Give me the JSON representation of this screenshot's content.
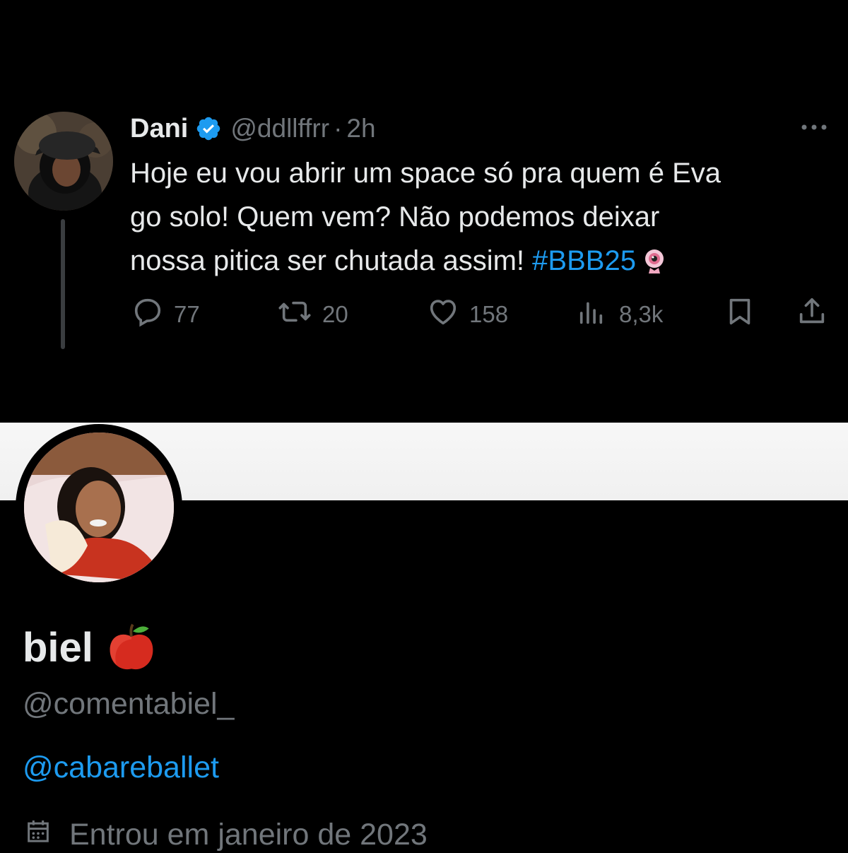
{
  "tweet": {
    "author_name": "Dani",
    "author_handle": "@ddllffrr",
    "separator": "·",
    "time": "2h",
    "text_line1": "Hoje eu vou abrir um space só pra quem é Eva",
    "text_line2": "go solo! Quem vem? Não podemos deixar",
    "text_line3": "nossa pitica ser chutada assim! ",
    "hashtag": "#BBB25",
    "emoji": "camera-emoji",
    "replies": "77",
    "retweets": "20",
    "likes": "158",
    "views": "8,3k",
    "icons": [
      "verified-badge-icon",
      "more-icon",
      "reply-icon",
      "retweet-icon",
      "like-icon",
      "views-icon",
      "bookmark-icon",
      "share-icon"
    ]
  },
  "profile": {
    "name": "biel",
    "name_emoji": "apple-emoji",
    "handle": "@comentabiel_",
    "link": "@cabareballet",
    "joined": "Entrou em janeiro de 2023",
    "icons": [
      "calendar-icon"
    ]
  },
  "colors": {
    "background": "#000000",
    "text_primary": "#e7e9ea",
    "text_secondary": "#71767b",
    "accent": "#1d9bf0",
    "divider_band": "#f5f5f5"
  }
}
